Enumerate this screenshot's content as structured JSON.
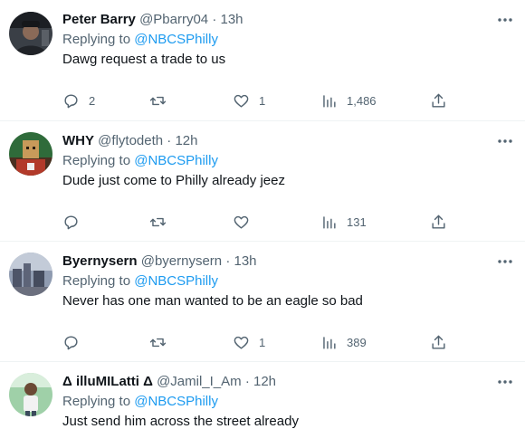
{
  "tweets": [
    {
      "name": "Peter Barry",
      "handle": "@Pbarry04",
      "time": "13h",
      "replying_label": "Replying to",
      "replying_to": "@NBCSPhilly",
      "text": "Dawg request a trade to us",
      "replies": "2",
      "retweets": "",
      "likes": "1",
      "views": "1,486"
    },
    {
      "name": "WHY",
      "handle": "@flytodeth",
      "time": "12h",
      "replying_label": "Replying to",
      "replying_to": "@NBCSPhilly",
      "text": "Dude just come to Philly already jeez",
      "replies": "",
      "retweets": "",
      "likes": "",
      "views": "131"
    },
    {
      "name": "Byernysern",
      "handle": "@byernysern",
      "time": "13h",
      "replying_label": "Replying to",
      "replying_to": "@NBCSPhilly",
      "text": "Never has one man wanted to be an eagle so bad",
      "replies": "",
      "retweets": "",
      "likes": "1",
      "views": "389"
    },
    {
      "name": "Δ illuMILatti Δ",
      "handle": "@Jamil_I_Am",
      "time": "12h",
      "replying_label": "Replying to",
      "replying_to": "@NBCSPhilly",
      "text": "Just send him across the street already"
    }
  ],
  "separator": "·",
  "icons": {
    "reply": "reply-icon",
    "retweet": "retweet-icon",
    "like": "heart-icon",
    "views": "views-icon",
    "share": "share-icon",
    "more": "more-icon"
  },
  "colors": {
    "text": "#0f1419",
    "muted": "#536471",
    "link": "#1d9bf0",
    "divider": "#eff3f4"
  }
}
